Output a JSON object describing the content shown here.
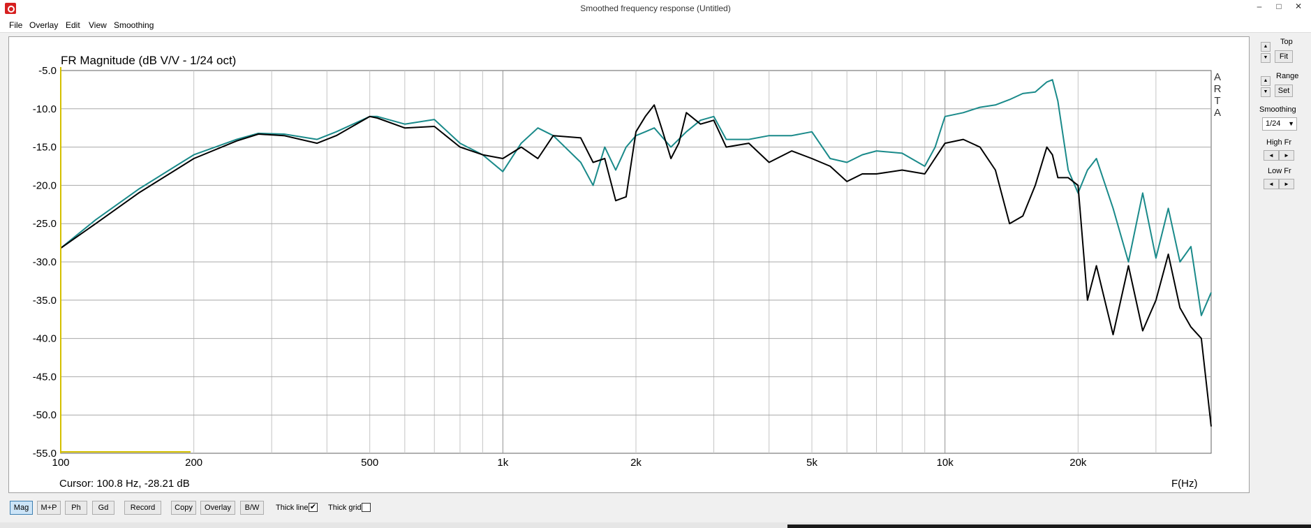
{
  "window": {
    "title": "Smoothed frequency response (Untitled)",
    "minimize": "–",
    "maximize": "□",
    "close": "✕"
  },
  "menu": [
    "File",
    "Overlay",
    "Edit",
    "View",
    "Smoothing"
  ],
  "chart_data": {
    "type": "line",
    "title": "FR Magnitude (dB V/V - 1/24 oct)",
    "xlabel": "F(Hz)",
    "ylabel": "",
    "xscale": "log",
    "xlim": [
      100,
      40000
    ],
    "ylim": [
      -55,
      -5
    ],
    "xticks": [
      {
        "value": 100,
        "label": "100"
      },
      {
        "value": 200,
        "label": "200"
      },
      {
        "value": 500,
        "label": "500"
      },
      {
        "value": 1000,
        "label": "1k"
      },
      {
        "value": 2000,
        "label": "2k"
      },
      {
        "value": 5000,
        "label": "5k"
      },
      {
        "value": 10000,
        "label": "10k"
      },
      {
        "value": 20000,
        "label": "20k"
      }
    ],
    "yticks": [
      "-5.0",
      "-10.0",
      "-15.0",
      "-20.0",
      "-25.0",
      "-30.0",
      "-35.0",
      "-40.0",
      "-45.0",
      "-50.0",
      "-55.0"
    ],
    "watermark": "ARTA",
    "cursor": "Cursor: 100.8 Hz, -28.21 dB",
    "grid": true,
    "series": [
      {
        "color": "#1a8a8a",
        "x": [
          100,
          120,
          150,
          200,
          250,
          280,
          320,
          380,
          420,
          500,
          520,
          600,
          700,
          800,
          900,
          1000,
          1100,
          1200,
          1300,
          1500,
          1600,
          1700,
          1800,
          1900,
          2000,
          2100,
          2200,
          2400,
          2600,
          2800,
          3000,
          3200,
          3600,
          4000,
          4500,
          5000,
          5500,
          6000,
          6500,
          7000,
          8000,
          9000,
          9500,
          10000,
          11000,
          12000,
          13000,
          14000,
          15000,
          16000,
          17000,
          17500,
          18000,
          19000,
          20000,
          21000,
          22000,
          24000,
          26000,
          28000,
          30000,
          32000,
          34000,
          36000,
          38000,
          40000
        ],
        "y": [
          -28.2,
          -24.5,
          -20.5,
          -16,
          -14,
          -13.2,
          -13.3,
          -14,
          -13,
          -11,
          -11,
          -12,
          -11.4,
          -14.5,
          -16,
          -18.2,
          -14.5,
          -12.5,
          -13.5,
          -17,
          -20,
          -15,
          -18,
          -15,
          -13.5,
          -13,
          -12.5,
          -15,
          -13,
          -11.5,
          -11,
          -14,
          -14,
          -13.5,
          -13.5,
          -13,
          -16.5,
          -17,
          -16,
          -15.5,
          -15.8,
          -17.5,
          -15,
          -11,
          -10.5,
          -9.8,
          -9.5,
          -8.8,
          -8,
          -7.8,
          -6.5,
          -6.2,
          -9,
          -18,
          -21,
          -18,
          -16.5,
          -23,
          -30,
          -21,
          -29.5,
          -23,
          -30,
          -28,
          -37,
          -34
        ]
      },
      {
        "color": "#000000",
        "x": [
          100,
          120,
          150,
          200,
          250,
          280,
          320,
          380,
          420,
          500,
          520,
          600,
          700,
          800,
          900,
          1000,
          1100,
          1200,
          1300,
          1500,
          1600,
          1700,
          1800,
          1900,
          2000,
          2100,
          2200,
          2300,
          2400,
          2500,
          2600,
          2800,
          3000,
          3200,
          3600,
          4000,
          4500,
          5000,
          5500,
          6000,
          6500,
          7000,
          8000,
          9000,
          10000,
          11000,
          12000,
          13000,
          14000,
          15000,
          16000,
          17000,
          17500,
          18000,
          19000,
          20000,
          21000,
          22000,
          24000,
          26000,
          28000,
          30000,
          32000,
          34000,
          36000,
          38000,
          40000
        ],
        "y": [
          -28.2,
          -25,
          -21,
          -16.5,
          -14.2,
          -13.3,
          -13.5,
          -14.5,
          -13.5,
          -11,
          -11.2,
          -12.5,
          -12.3,
          -15,
          -16,
          -16.5,
          -15,
          -16.5,
          -13.5,
          -13.8,
          -17,
          -16.5,
          -22,
          -21.5,
          -13,
          -11,
          -9.5,
          -13,
          -16.5,
          -14.5,
          -10.5,
          -12,
          -11.5,
          -15,
          -14.5,
          -17,
          -15.5,
          -16.5,
          -17.5,
          -19.5,
          -18.5,
          -18.5,
          -18,
          -18.5,
          -14.5,
          -14,
          -15,
          -18,
          -25,
          -24,
          -20,
          -15,
          -16,
          -19,
          -19,
          -20,
          -35,
          -30.5,
          -39.5,
          -30.5,
          -39,
          -35,
          -29,
          -36,
          -38.5,
          -40,
          -51.5
        ]
      }
    ]
  },
  "sidebar": {
    "top_label": "Top",
    "fit": "Fit",
    "range_label": "Range",
    "set": "Set",
    "smoothing_label": "Smoothing",
    "smoothing_value": "1/24",
    "highfr_label": "High Fr",
    "lowfr_label": "Low Fr",
    "up": "▲",
    "down": "▼",
    "left": "◄",
    "right": "►"
  },
  "toolbar": {
    "mag": "Mag",
    "mp": "M+P",
    "ph": "Ph",
    "gd": "Gd",
    "record": "Record",
    "copy": "Copy",
    "overlay": "Overlay",
    "bw": "B/W",
    "thick_line": "Thick line",
    "thick_line_checked": "✔",
    "thick_grid": "Thick grid"
  }
}
